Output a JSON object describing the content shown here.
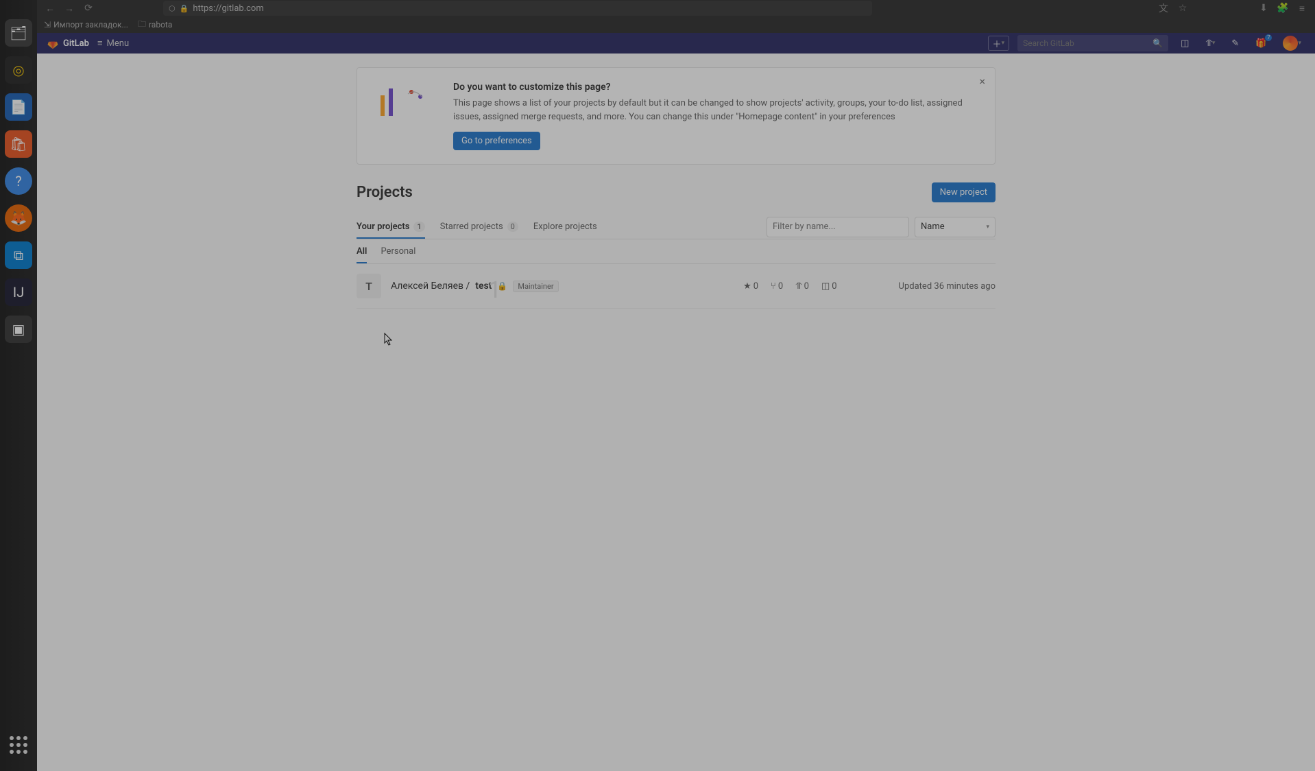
{
  "browser": {
    "url": "https://gitlab.com",
    "bookmarks": {
      "import": "Импорт закладок...",
      "rabota": "rabota"
    }
  },
  "gitlab_header": {
    "brand": "GitLab",
    "menu": "Menu",
    "search_placeholder": "Search GitLab",
    "whats_new_count": "7"
  },
  "banner": {
    "title": "Do you want to customize this page?",
    "text": "This page shows a list of your projects by default but it can be changed to show projects' activity, groups, your to-do list, assigned issues, assigned merge requests, and more. You can change this under \"Homepage content\" in your preferences",
    "button": "Go to preferences"
  },
  "projects": {
    "heading": "Projects",
    "new_button": "New project",
    "tabs": {
      "your": {
        "label": "Your projects",
        "count": "1"
      },
      "starred": {
        "label": "Starred projects",
        "count": "0"
      },
      "explore": {
        "label": "Explore projects"
      }
    },
    "filter_placeholder": "Filter by name...",
    "sort_label": "Name",
    "sub_tabs": {
      "all": "All",
      "personal": "Personal"
    },
    "row": {
      "avatar_letter": "T",
      "owner": "Алексей Беляев / ",
      "name": "test",
      "role": "Maintainer",
      "stars": "0",
      "forks": "0",
      "mrs": "0",
      "issues": "0",
      "updated": "Updated 36 minutes ago"
    }
  },
  "overlay_number": "1"
}
